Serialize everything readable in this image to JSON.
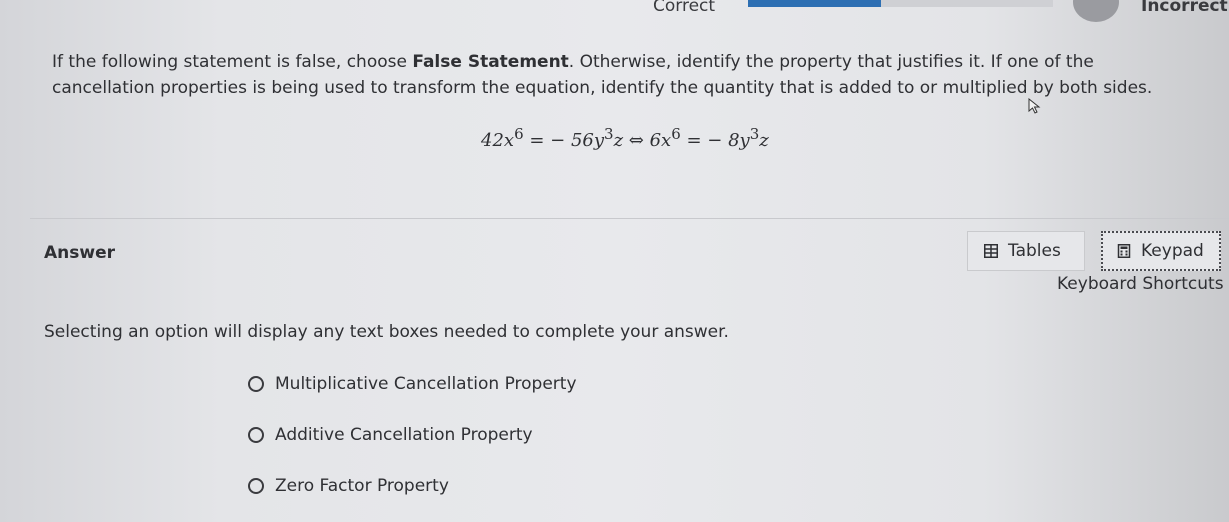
{
  "header": {
    "correct_label": "Correct",
    "incorrect_label": "Incorrect",
    "progress_fraction": 0.44
  },
  "question": {
    "prefix": "If the following statement is false, choose ",
    "bold_phrase": "False Statement",
    "suffix": ". Otherwise, identify the property that justifies it. If one of the cancellation properties is being used to transform the equation, identify the quantity that is added to or multiplied by both sides."
  },
  "equation": {
    "left_a": "42x",
    "left_a_exp": "6",
    "left_eq": " = − 56y",
    "left_b_exp": "3",
    "left_b_tail": "z",
    "iff": " ⇔ ",
    "right_a": "6x",
    "right_a_exp": "6",
    "right_eq": " = − 8y",
    "right_b_exp": "3",
    "right_b_tail": "z"
  },
  "answer": {
    "label": "Answer",
    "tables_label": "Tables",
    "keypad_label": "Keypad",
    "shortcuts_label": "Keyboard Shortcuts",
    "instruction": "Selecting an option will display any text boxes needed to complete your answer.",
    "options": [
      "Multiplicative Cancellation Property",
      "Additive Cancellation Property",
      "Zero Factor Property"
    ]
  },
  "icons": {
    "tables": "table-icon",
    "keypad": "calculator-icon",
    "cursor": "mouse-pointer-icon"
  }
}
